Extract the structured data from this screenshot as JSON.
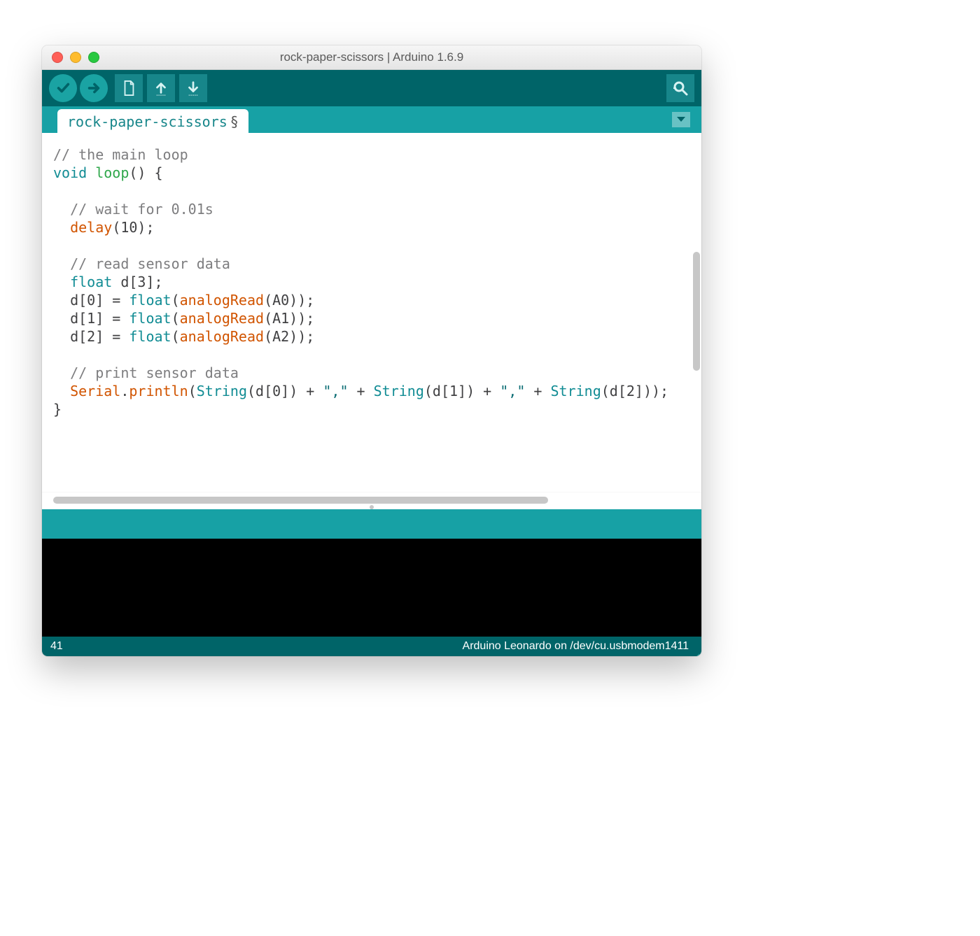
{
  "window": {
    "title": "rock-paper-scissors | Arduino 1.6.9"
  },
  "toolbar": {
    "verify_icon": "check",
    "upload_icon": "arrow-right",
    "new_icon": "file",
    "open_icon": "arrow-up",
    "save_icon": "arrow-down",
    "serial_monitor_icon": "magnifier"
  },
  "tabstrip": {
    "tab_label": "rock-paper-scissors",
    "tab_mark": "§",
    "dropdown_icon": "triangle-down"
  },
  "editor": {
    "lines": [
      {
        "t": "comment",
        "text": "// the main loop"
      },
      {
        "t": "code",
        "html": "<span class='c-keyword'>void</span> <span class='c-func'>loop</span>() {"
      },
      {
        "t": "blank",
        "text": ""
      },
      {
        "t": "comment",
        "text": "  // wait for 0.01s"
      },
      {
        "t": "code",
        "html": "  <span class='c-builtin'>delay</span>(10);"
      },
      {
        "t": "blank",
        "text": ""
      },
      {
        "t": "comment",
        "text": "  // read sensor data"
      },
      {
        "t": "code",
        "html": "  <span class='c-type'>float</span> d[3];"
      },
      {
        "t": "code",
        "html": "  d[0] = <span class='c-type'>float</span>(<span class='c-builtin'>analogRead</span>(A0));"
      },
      {
        "t": "code",
        "html": "  d[1] = <span class='c-type'>float</span>(<span class='c-builtin'>analogRead</span>(A1));"
      },
      {
        "t": "code",
        "html": "  d[2] = <span class='c-type'>float</span>(<span class='c-builtin'>analogRead</span>(A2));"
      },
      {
        "t": "blank",
        "text": ""
      },
      {
        "t": "comment",
        "text": "  // print sensor data"
      },
      {
        "t": "code",
        "html": "  <span class='c-builtin'>Serial</span>.<span class='c-builtin'>println</span>(<span class='c-type'>String</span>(d[0]) + <span class='c-str'>\",\"</span> + <span class='c-type'>String</span>(d[1]) + <span class='c-str'>\",\"</span> + <span class='c-type'>String</span>(d[2]));"
      },
      {
        "t": "code",
        "html": "}"
      }
    ]
  },
  "statusbar": {
    "line_number": "41",
    "board_info": "Arduino Leonardo on /dev/cu.usbmodem1411"
  },
  "colors": {
    "teal_dark": "#006468",
    "teal_mid": "#17868a",
    "teal_light": "#17a1a5",
    "teal_btn": "#1aa3a3"
  }
}
